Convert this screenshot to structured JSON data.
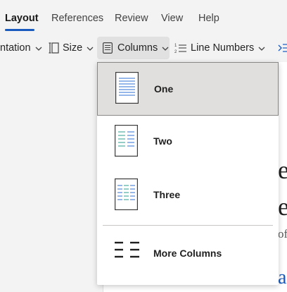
{
  "tabs": [
    {
      "label": "Layout",
      "active": true
    },
    {
      "label": "References"
    },
    {
      "label": "Review"
    },
    {
      "label": "View"
    },
    {
      "label": "Help"
    }
  ],
  "ribbon": {
    "orientation_label": "ntation",
    "size_label": "Size",
    "columns_label": "Columns",
    "line_numbers_label": "Line Numbers"
  },
  "document_fragments": [
    "e",
    "e",
    "of",
    "a"
  ],
  "columns_menu": {
    "items": [
      {
        "label": "One",
        "icon": "one-column-icon",
        "selected": true
      },
      {
        "label": "Two",
        "icon": "two-columns-icon"
      },
      {
        "label": "Three",
        "icon": "three-columns-icon"
      },
      {
        "label": "More Columns",
        "icon": "more-columns-icon"
      }
    ]
  },
  "colors": {
    "accent": "#185abd",
    "selected_bg": "#e0dfdd",
    "line_blue": "#2e6fd6",
    "line_teal": "#2a9c8e"
  }
}
